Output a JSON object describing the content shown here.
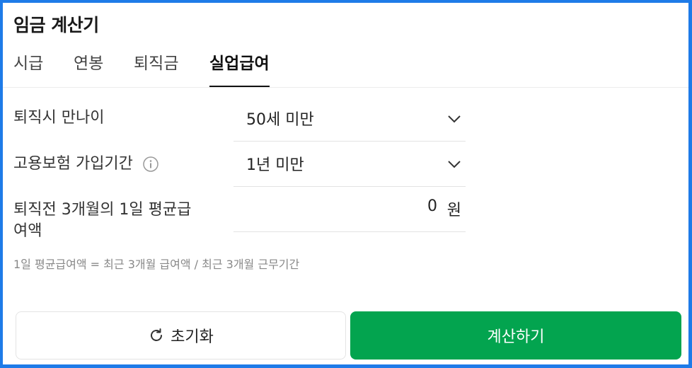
{
  "app": {
    "title": "임금 계산기"
  },
  "tabs": [
    {
      "label": "시급",
      "active": false
    },
    {
      "label": "연봉",
      "active": false
    },
    {
      "label": "퇴직금",
      "active": false
    },
    {
      "label": "실업급여",
      "active": true
    }
  ],
  "form": {
    "age": {
      "label": "퇴직시 만나이",
      "value": "50세 미만"
    },
    "insurance": {
      "label": "고용보험 가입기간",
      "value": "1년 미만",
      "info_icon": "info-icon"
    },
    "wage": {
      "label_line1": "퇴직전 3개월의 1일 평균급",
      "label_line2": "여액",
      "value": "0",
      "unit": "원"
    }
  },
  "note": "1일 평균급여액 = 최근 3개월 급여액 / 최근 3개월 근무기간",
  "buttons": {
    "reset": {
      "label": "초기화",
      "icon": "refresh-icon"
    },
    "calculate": {
      "label": "계산하기"
    }
  },
  "colors": {
    "frame_border": "#1e7be8",
    "primary": "#03a44f"
  }
}
